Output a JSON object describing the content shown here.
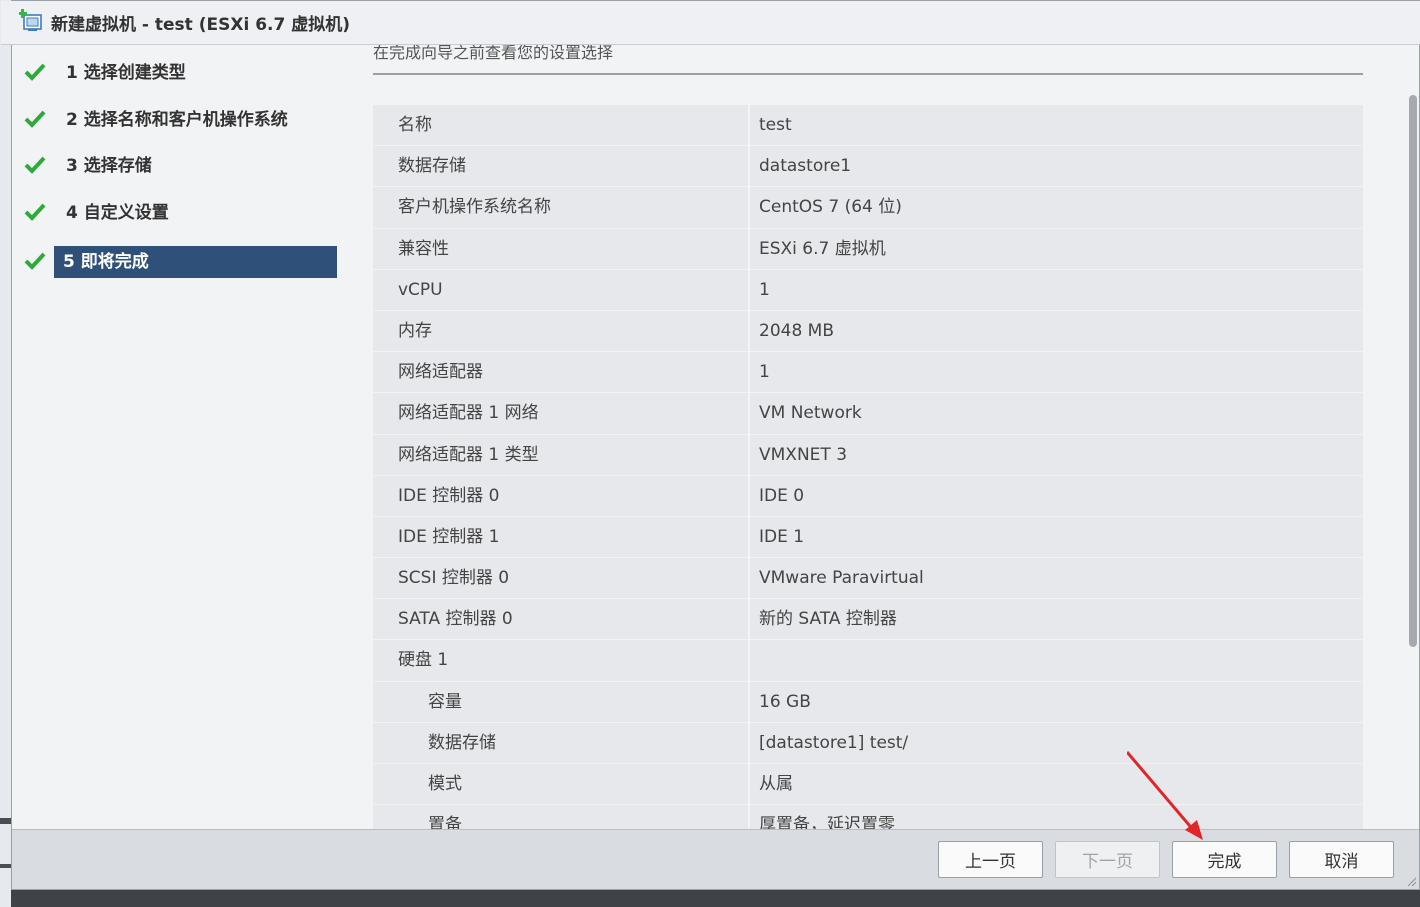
{
  "window": {
    "title": "新建虚拟机 - test (ESXi 6.7 虚拟机)"
  },
  "steps": [
    {
      "label": "1 选择创建类型",
      "active": false
    },
    {
      "label": "2 选择名称和客户机操作系统",
      "active": false
    },
    {
      "label": "3 选择存储",
      "active": false
    },
    {
      "label": "4 自定义设置",
      "active": false
    },
    {
      "label": "5 即将完成",
      "active": true
    }
  ],
  "main": {
    "hint": "在完成向导之前查看您的设置选择",
    "rows": [
      {
        "key": "名称",
        "value": "test",
        "sub": false
      },
      {
        "key": "数据存储",
        "value": "datastore1",
        "sub": false
      },
      {
        "key": "客户机操作系统名称",
        "value": "CentOS 7 (64 位)",
        "sub": false
      },
      {
        "key": "兼容性",
        "value": "ESXi 6.7 虚拟机",
        "sub": false
      },
      {
        "key": "vCPU",
        "value": "1",
        "sub": false
      },
      {
        "key": "内存",
        "value": "2048 MB",
        "sub": false
      },
      {
        "key": "网络适配器",
        "value": "1",
        "sub": false
      },
      {
        "key": "网络适配器 1 网络",
        "value": "VM Network",
        "sub": false
      },
      {
        "key": "网络适配器 1 类型",
        "value": "VMXNET 3",
        "sub": false
      },
      {
        "key": "IDE 控制器 0",
        "value": "IDE 0",
        "sub": false
      },
      {
        "key": "IDE 控制器 1",
        "value": "IDE 1",
        "sub": false
      },
      {
        "key": "SCSI 控制器 0",
        "value": "VMware Paravirtual",
        "sub": false
      },
      {
        "key": "SATA 控制器 0",
        "value": "新的 SATA 控制器",
        "sub": false
      },
      {
        "key": "硬盘 1",
        "value": "",
        "sub": false
      },
      {
        "key": "容量",
        "value": "16 GB",
        "sub": true
      },
      {
        "key": "数据存储",
        "value": "[datastore1] test/",
        "sub": true
      },
      {
        "key": "模式",
        "value": "从属",
        "sub": true
      },
      {
        "key": "置备",
        "value": "厚置备，延迟置零",
        "sub": true
      }
    ]
  },
  "footer": {
    "prev": "上一页",
    "next": "下一页",
    "finish": "完成",
    "cancel": "取消"
  },
  "colors": {
    "active_step": "#2f5078",
    "check": "#2eaa3a",
    "annotation_arrow": "#e0262b"
  }
}
